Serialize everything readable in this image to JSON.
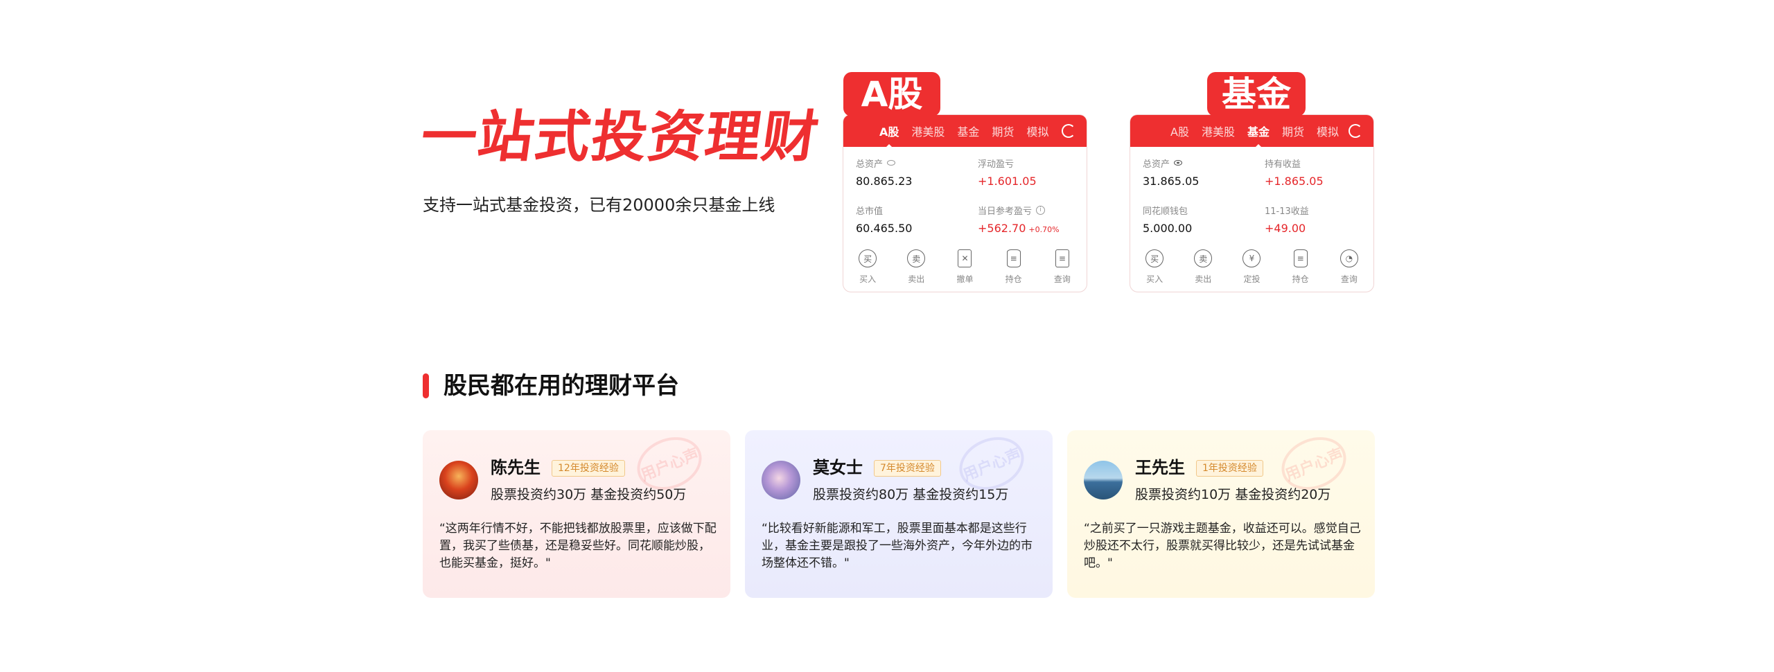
{
  "hero": {
    "title": "一站式投资理财",
    "subtitle": "支持一站式基金投资，已有20000余只基金上线"
  },
  "stock_card": {
    "badge": "A股",
    "tabs": [
      "A股",
      "港美股",
      "基金",
      "期货",
      "模拟"
    ],
    "active_tab": "A股",
    "fields": [
      {
        "label": "总资产",
        "value": "80.865.23"
      },
      {
        "label": "浮动盈亏",
        "value": "+1.601.05"
      },
      {
        "label": "总市值",
        "value": "60.465.50"
      },
      {
        "label": "当日参考盈亏",
        "value": "+562.70",
        "extra": "+0.70%"
      }
    ],
    "actions": [
      {
        "label": "买入",
        "glyph": "买"
      },
      {
        "label": "卖出",
        "glyph": "卖"
      },
      {
        "label": "撤单",
        "glyph": "✕"
      },
      {
        "label": "持仓",
        "glyph": "≡"
      },
      {
        "label": "查询",
        "glyph": "≡"
      }
    ]
  },
  "fund_card": {
    "badge": "基金",
    "tabs": [
      "A股",
      "港美股",
      "基金",
      "期货",
      "模拟"
    ],
    "active_tab": "基金",
    "fields": [
      {
        "label": "总资产",
        "value": "31.865.05"
      },
      {
        "label": "持有收益",
        "value": "+1.865.05"
      },
      {
        "label": "同花顺钱包",
        "value": "5.000.00"
      },
      {
        "label": "11-13收益",
        "value": "+49.00"
      }
    ],
    "actions": [
      {
        "label": "买入",
        "glyph": "买"
      },
      {
        "label": "卖出",
        "glyph": "卖"
      },
      {
        "label": "定投",
        "glyph": "¥"
      },
      {
        "label": "持仓",
        "glyph": "≡"
      },
      {
        "label": "查询",
        "glyph": "◔"
      }
    ]
  },
  "section": {
    "title": "股民都在用的理财平台"
  },
  "testimonials": [
    {
      "name": "陈先生",
      "experience": "12年投资经验",
      "assets": "股票投资约30万  基金投资约50万",
      "quote": "“这两年行情不好，不能把钱都放股票里，应该做下配置，我买了些债基，还是稳妥些好。同花顺能炒股，也能买基金，挺好。\"",
      "stamp": "用户心声"
    },
    {
      "name": "莫女士",
      "experience": "7年投资经验",
      "assets": "股票投资约80万  基金投资约15万",
      "quote": "“比较看好新能源和军工，股票里面基本都是这些行业，基金主要是跟投了一些海外资产，今年外边的市场整体还不错。\"",
      "stamp": "用户心声"
    },
    {
      "name": "王先生",
      "experience": "1年投资经验",
      "assets": "股票投资约10万  基金投资约20万",
      "quote": "“之前买了一只游戏主题基金，收益还可以。感觉自己炒股还不太行，股票就买得比较少，还是先试试基金吧。\"",
      "stamp": "用户心声"
    }
  ],
  "colors": {
    "brand_red": "#ee2f30",
    "value_red": "#e5262a"
  }
}
